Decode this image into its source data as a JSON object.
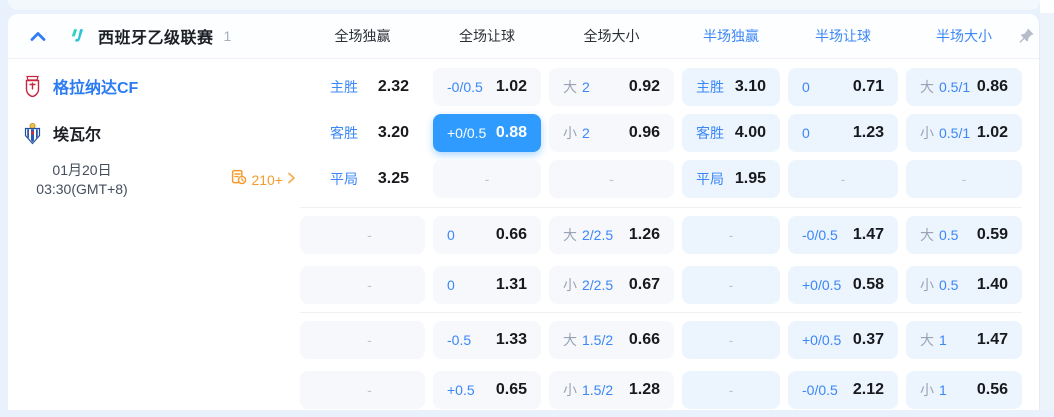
{
  "colors": {
    "accent_blue": "#3b87f7",
    "selected_blue": "#2f9bff",
    "orange": "#f59b2d",
    "page_bg": "#e8f1fc",
    "full_cell_bg": "#f6f8fb",
    "half_cell_bg": "#ecf4fe"
  },
  "dash": "-",
  "header": {
    "league": "西班牙乙级联赛",
    "count": "1",
    "columns": [
      {
        "label": "全场独赢",
        "scope": "full"
      },
      {
        "label": "全场让球",
        "scope": "full"
      },
      {
        "label": "全场大小",
        "scope": "full"
      },
      {
        "label": "半场独赢",
        "scope": "half"
      },
      {
        "label": "半场让球",
        "scope": "half"
      },
      {
        "label": "半场大小",
        "scope": "half"
      }
    ],
    "icons": [
      "collapse-chevron-up",
      "league-logo",
      "pin"
    ]
  },
  "match": {
    "home": "格拉纳达CF",
    "away": "埃瓦尔",
    "date": "01月20日",
    "time": "03:30(GMT+8)",
    "more_markets": "210+"
  },
  "sections": [
    {
      "rows": [
        [
          {
            "kind": "win",
            "label": "主胜",
            "odds": "2.32",
            "bg": "plain"
          },
          {
            "kind": "hcp",
            "label": "-0/0.5",
            "odds": "1.02",
            "bg": "full"
          },
          {
            "kind": "ou",
            "side": "大",
            "line": "2",
            "odds": "0.92",
            "bg": "full"
          },
          {
            "kind": "win",
            "label": "主胜",
            "odds": "3.10",
            "bg": "half"
          },
          {
            "kind": "hcp",
            "label": "0",
            "odds": "0.71",
            "bg": "half"
          },
          {
            "kind": "ou",
            "side": "大",
            "line": "0.5/1",
            "odds": "0.86",
            "bg": "half"
          }
        ],
        [
          {
            "kind": "win",
            "label": "客胜",
            "odds": "3.20",
            "bg": "plain"
          },
          {
            "kind": "hcp",
            "label": "+0/0.5",
            "odds": "0.88",
            "bg": "selected"
          },
          {
            "kind": "ou",
            "side": "小",
            "line": "2",
            "odds": "0.96",
            "bg": "full"
          },
          {
            "kind": "win",
            "label": "客胜",
            "odds": "4.00",
            "bg": "half"
          },
          {
            "kind": "hcp",
            "label": "0",
            "odds": "1.23",
            "bg": "half"
          },
          {
            "kind": "ou",
            "side": "小",
            "line": "0.5/1",
            "odds": "1.02",
            "bg": "half"
          }
        ],
        [
          {
            "kind": "win",
            "label": "平局",
            "odds": "3.25",
            "bg": "plain"
          },
          {
            "kind": "dash",
            "bg": "full"
          },
          {
            "kind": "dash",
            "bg": "full"
          },
          {
            "kind": "win",
            "label": "平局",
            "odds": "1.95",
            "bg": "half"
          },
          {
            "kind": "dash",
            "bg": "half"
          },
          {
            "kind": "dash",
            "bg": "half"
          }
        ]
      ]
    },
    {
      "rows": [
        [
          {
            "kind": "dash",
            "bg": "full"
          },
          {
            "kind": "hcp",
            "label": "0",
            "odds": "0.66",
            "bg": "full"
          },
          {
            "kind": "ou",
            "side": "大",
            "line": "2/2.5",
            "odds": "1.26",
            "bg": "full"
          },
          {
            "kind": "dash",
            "bg": "half"
          },
          {
            "kind": "hcp",
            "label": "-0/0.5",
            "odds": "1.47",
            "bg": "half"
          },
          {
            "kind": "ou",
            "side": "大",
            "line": "0.5",
            "odds": "0.59",
            "bg": "half"
          }
        ],
        [
          {
            "kind": "dash",
            "bg": "full"
          },
          {
            "kind": "hcp",
            "label": "0",
            "odds": "1.31",
            "bg": "full"
          },
          {
            "kind": "ou",
            "side": "小",
            "line": "2/2.5",
            "odds": "0.67",
            "bg": "full"
          },
          {
            "kind": "dash",
            "bg": "half"
          },
          {
            "kind": "hcp",
            "label": "+0/0.5",
            "odds": "0.58",
            "bg": "half"
          },
          {
            "kind": "ou",
            "side": "小",
            "line": "0.5",
            "odds": "1.40",
            "bg": "half"
          }
        ]
      ]
    },
    {
      "rows": [
        [
          {
            "kind": "dash",
            "bg": "full"
          },
          {
            "kind": "hcp",
            "label": "-0.5",
            "odds": "1.33",
            "bg": "full"
          },
          {
            "kind": "ou",
            "side": "大",
            "line": "1.5/2",
            "odds": "0.66",
            "bg": "full"
          },
          {
            "kind": "dash",
            "bg": "half"
          },
          {
            "kind": "hcp",
            "label": "+0/0.5",
            "odds": "0.37",
            "bg": "half"
          },
          {
            "kind": "ou",
            "side": "大",
            "line": "1",
            "odds": "1.47",
            "bg": "half"
          }
        ],
        [
          {
            "kind": "dash",
            "bg": "full"
          },
          {
            "kind": "hcp",
            "label": "+0.5",
            "odds": "0.65",
            "bg": "full"
          },
          {
            "kind": "ou",
            "side": "小",
            "line": "1.5/2",
            "odds": "1.28",
            "bg": "full"
          },
          {
            "kind": "dash",
            "bg": "half"
          },
          {
            "kind": "hcp",
            "label": "-0/0.5",
            "odds": "2.12",
            "bg": "half"
          },
          {
            "kind": "ou",
            "side": "小",
            "line": "1",
            "odds": "0.56",
            "bg": "half"
          }
        ]
      ]
    }
  ]
}
